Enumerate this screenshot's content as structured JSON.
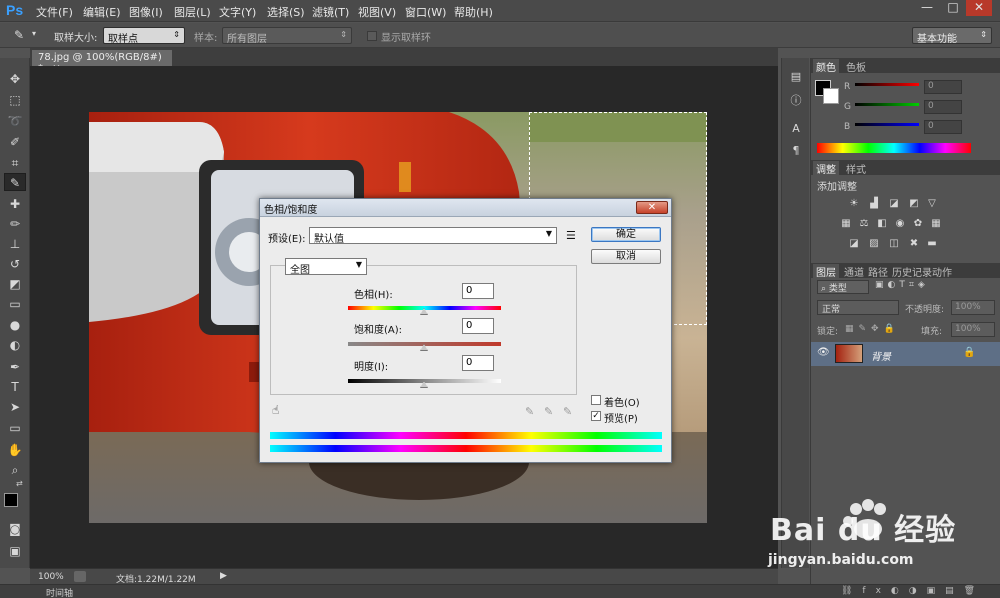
{
  "app": {
    "logo": "Ps"
  },
  "menu": [
    "文件(F)",
    "编辑(E)",
    "图像(I)",
    "图层(L)",
    "文字(Y)",
    "选择(S)",
    "滤镜(T)",
    "视图(V)",
    "窗口(W)",
    "帮助(H)"
  ],
  "window_controls": {
    "minimize": "—",
    "maximize": "□",
    "close": "✕"
  },
  "options": {
    "sample_size_label": "取样大小:",
    "sample_size_value": "取样点",
    "sample_label": "样本:",
    "sample_value": "所有图层",
    "show_ring_label": "显示取样环",
    "workspace": "基本功能"
  },
  "document": {
    "tab_title": "78.jpg @ 100%(RGB/8#) *",
    "tab_close": "×",
    "zoom": "100%",
    "doc_info": "文档:1.22M/1.22M"
  },
  "timeline_label": "时间轴",
  "panels": {
    "color_tabs": [
      "颜色",
      "色板"
    ],
    "color_channels": [
      {
        "label": "R",
        "value": "0",
        "color": "#d21a1a"
      },
      {
        "label": "G",
        "value": "0",
        "color": "#1ab01a"
      },
      {
        "label": "B",
        "value": "0",
        "color": "#1a1ad2"
      }
    ],
    "adjust_tabs": [
      "调整",
      "样式"
    ],
    "adjust_title": "添加调整",
    "layers_tabs": [
      "图层",
      "通道",
      "路径",
      "历史记录",
      "动作"
    ],
    "layers_filter": "类型",
    "blend_mode": "正常",
    "opacity_label": "不透明度:",
    "opacity_value": "100%",
    "lock_label": "锁定:",
    "fill_label": "填充:",
    "fill_value": "100%",
    "layer_name": "背景"
  },
  "dialog": {
    "title": "色相/饱和度",
    "close": "✕",
    "preset_label": "预设(E):",
    "preset_value": "默认值",
    "ok": "确定",
    "cancel": "取消",
    "channel": "全图",
    "hue_label": "色相(H):",
    "hue_value": "0",
    "saturation_label": "饱和度(A):",
    "saturation_value": "0",
    "lightness_label": "明度(I):",
    "lightness_value": "0",
    "colorize_label": "着色(O)",
    "colorize_checked": false,
    "preview_label": "预览(P)",
    "preview_checked": true
  },
  "watermark": {
    "brand": "Bai du 经验",
    "url": "jingyan.baidu.com"
  }
}
